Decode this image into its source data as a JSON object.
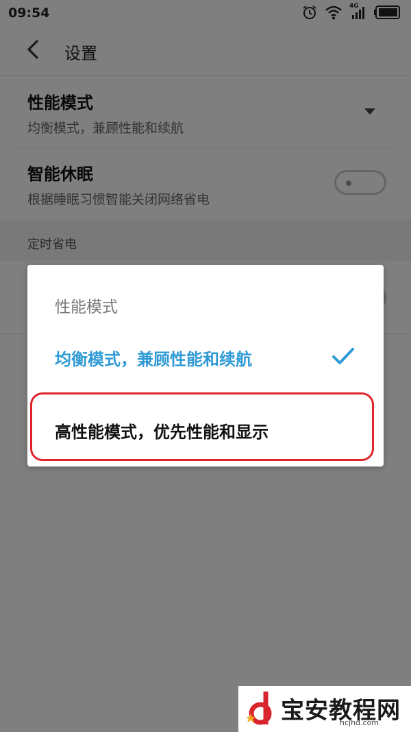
{
  "status_bar": {
    "time": "09:54",
    "icons": [
      "alarm-icon",
      "wifi-icon",
      "signal-4g-icon",
      "battery-icon"
    ],
    "network_label": "4G"
  },
  "header": {
    "title": "设置"
  },
  "settings": {
    "performance": {
      "title": "性能模式",
      "subtitle": "均衡模式，兼顾性能和续航"
    },
    "smart_sleep": {
      "title": "智能休眠",
      "subtitle": "根据睡眠习惯智能关闭网络省电",
      "enabled": false
    },
    "section_label": "定时省电"
  },
  "dialog": {
    "title": "性能模式",
    "options": [
      {
        "label": "均衡模式，兼顾性能和续航",
        "selected": true
      },
      {
        "label": "高性能模式，优先性能和显示",
        "selected": false
      }
    ]
  },
  "colors": {
    "accent": "#2f9ad6",
    "highlight": "#e0242c",
    "overlay": "rgba(0,0,0,0.5)"
  },
  "watermark": {
    "name": "宝安教程网",
    "url": "hcjhd.com"
  }
}
